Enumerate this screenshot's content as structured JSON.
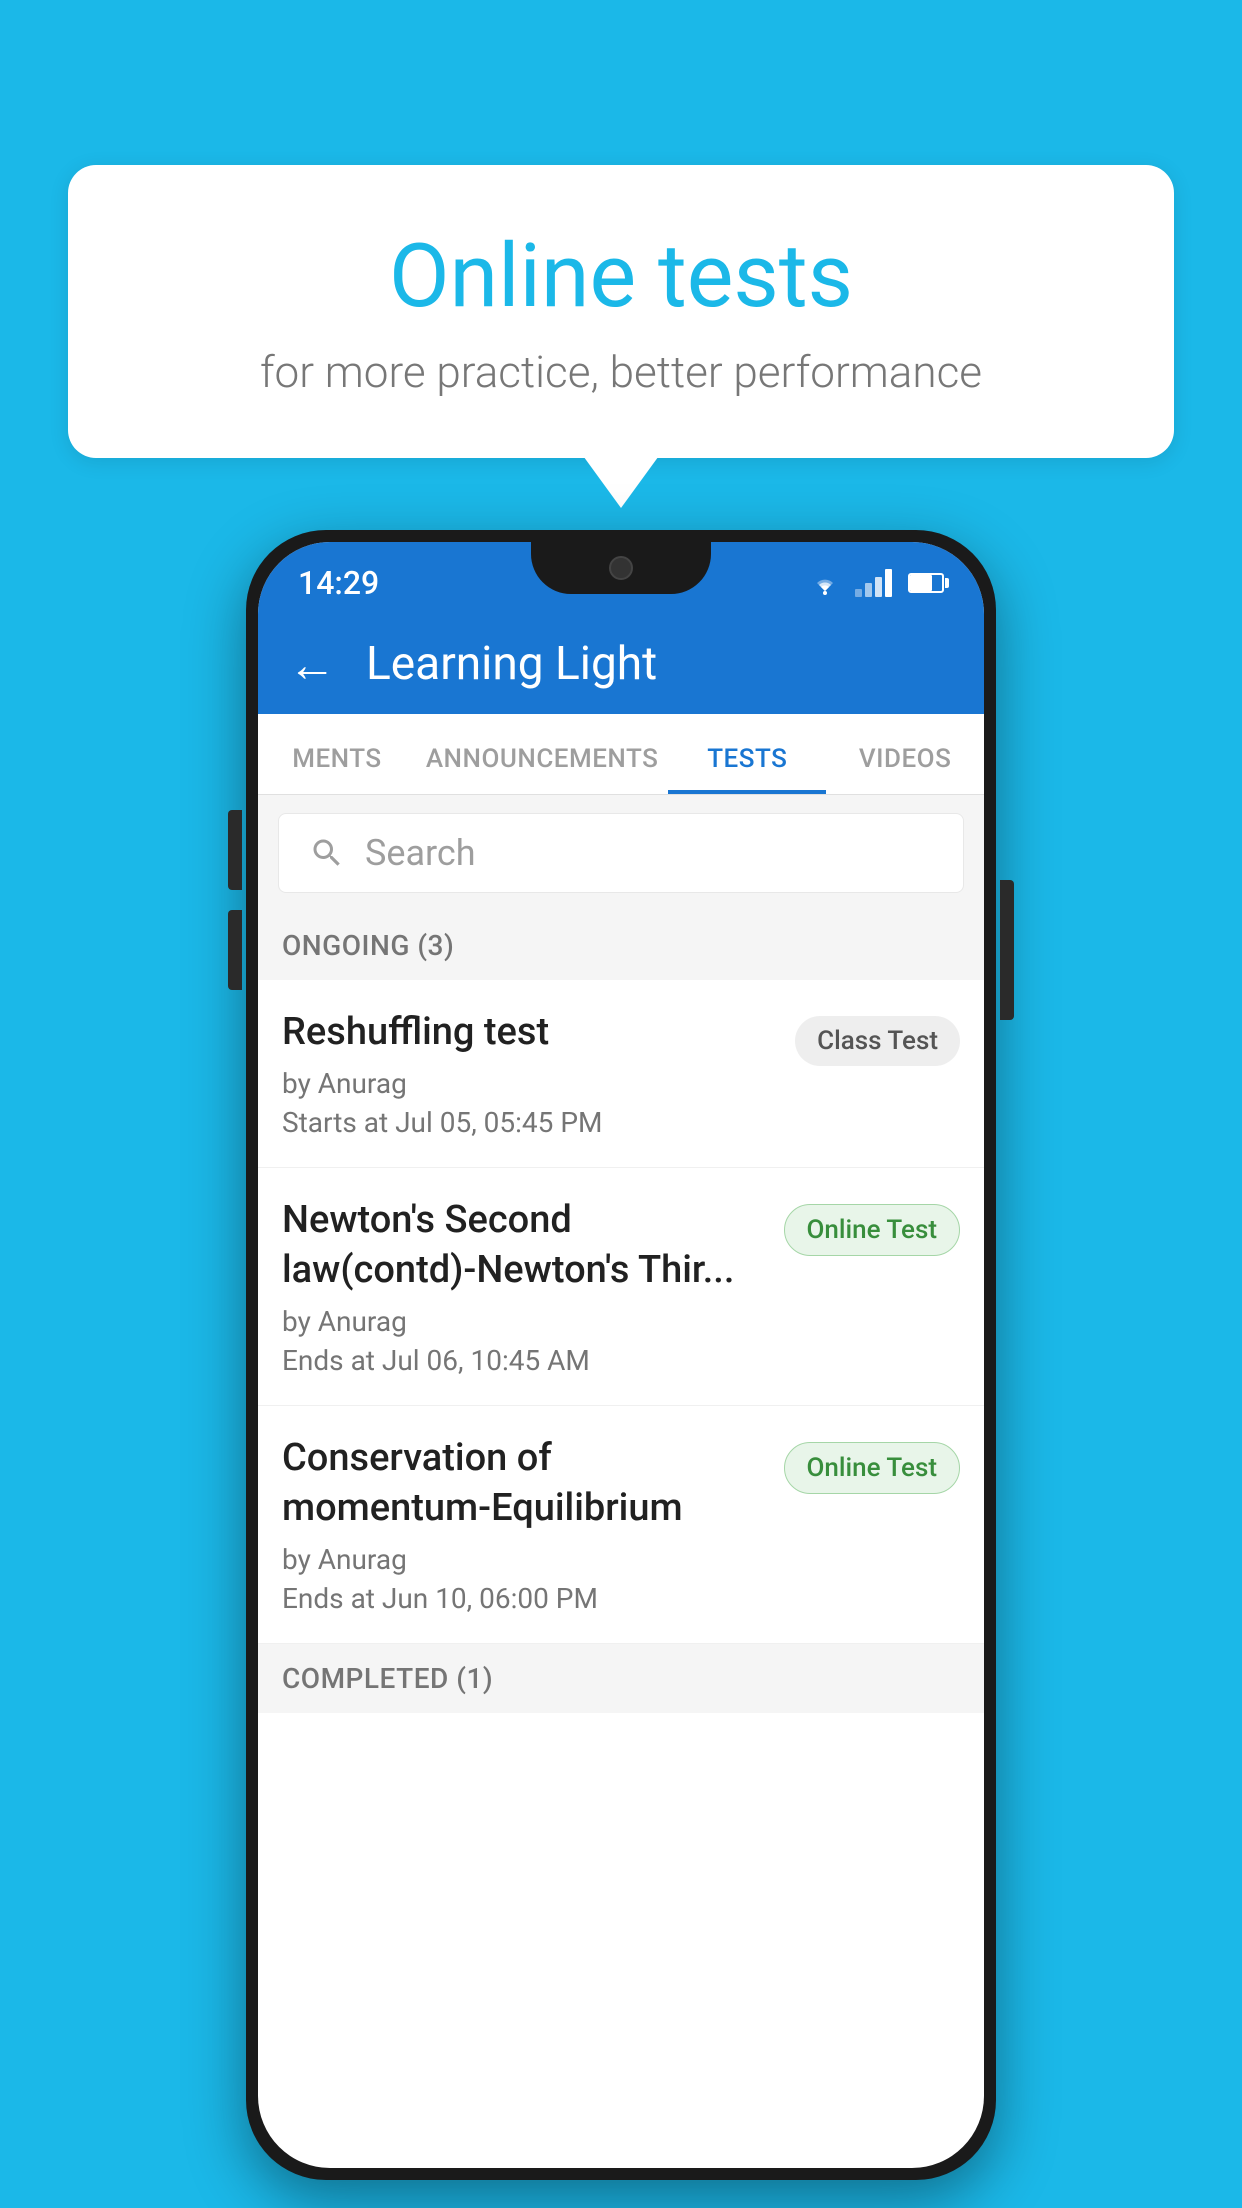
{
  "background_color": "#1bb8e8",
  "speech_bubble": {
    "title": "Online tests",
    "subtitle": "for more practice, better performance"
  },
  "phone": {
    "status_bar": {
      "time": "14:29"
    },
    "header": {
      "title": "Learning Light",
      "back_label": "←"
    },
    "tabs": [
      {
        "label": "MENTS",
        "active": false
      },
      {
        "label": "ANNOUNCEMENTS",
        "active": false
      },
      {
        "label": "TESTS",
        "active": true
      },
      {
        "label": "VIDEOS",
        "active": false
      }
    ],
    "search": {
      "placeholder": "Search"
    },
    "sections": [
      {
        "header": "ONGOING (3)",
        "tests": [
          {
            "name": "Reshuffling test",
            "author": "by Anurag",
            "date": "Starts at  Jul 05, 05:45 PM",
            "badge": "Class Test",
            "badge_type": "class"
          },
          {
            "name": "Newton's Second law(contd)-Newton's Thir...",
            "author": "by Anurag",
            "date": "Ends at  Jul 06, 10:45 AM",
            "badge": "Online Test",
            "badge_type": "online"
          },
          {
            "name": "Conservation of momentum-Equilibrium",
            "author": "by Anurag",
            "date": "Ends at  Jun 10, 06:00 PM",
            "badge": "Online Test",
            "badge_type": "online"
          }
        ]
      },
      {
        "header": "COMPLETED (1)",
        "tests": []
      }
    ]
  }
}
